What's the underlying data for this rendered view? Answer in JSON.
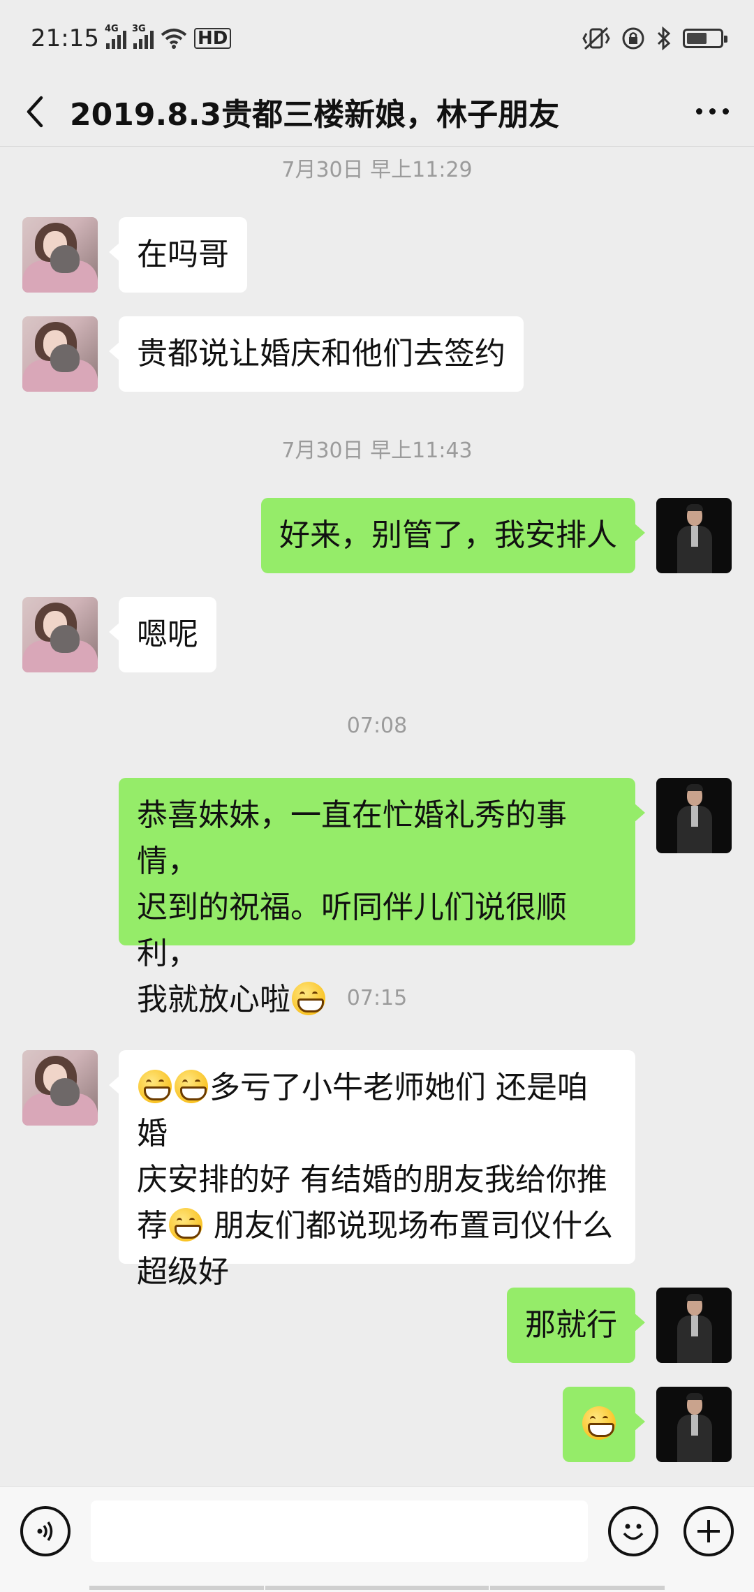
{
  "status_bar": {
    "time": "21:15",
    "sim1": "4G",
    "sim2": "3G",
    "hd": "HD",
    "battery_level": 0.6
  },
  "header": {
    "title": "2019.8.3贵都三楼新娘，林子朋友",
    "back_icon": "chevron-left-icon",
    "more_icon": "more-dots-icon"
  },
  "messages": [
    {
      "type": "timestamp",
      "text": "7月30日 早上11:29"
    },
    {
      "type": "in",
      "text": "在吗哥"
    },
    {
      "type": "in",
      "text": "贵都说让婚庆和他们去签约"
    },
    {
      "type": "timestamp",
      "text": "7月30日 早上11:43"
    },
    {
      "type": "out",
      "text": "好来，别管了，我安排人"
    },
    {
      "type": "in",
      "text": "嗯呢"
    },
    {
      "type": "timestamp",
      "text": "07:08"
    },
    {
      "type": "out",
      "line1": "恭喜妹妹，一直在忙婚礼秀的事情，",
      "line2": "迟到的祝福。听同伴儿们说很顺利，",
      "line3": "我就放心啦"
    },
    {
      "type": "timestamp",
      "text": "07:15"
    },
    {
      "type": "in",
      "line1": "多亏了小牛老师她们 还是咱婚",
      "line2": "庆安排的好  有结婚的朋友我给你推",
      "line3a": "荐",
      "line3b": " 朋友们都说现场布置司仪什么",
      "line4": "超级好"
    },
    {
      "type": "out",
      "text": "那就行"
    },
    {
      "type": "out",
      "emoji": "grinning-emoji"
    }
  ],
  "input_bar": {
    "voice_icon": "voice-icon",
    "emoji_icon": "emoji-icon",
    "plus_icon": "plus-icon",
    "placeholder": ""
  }
}
